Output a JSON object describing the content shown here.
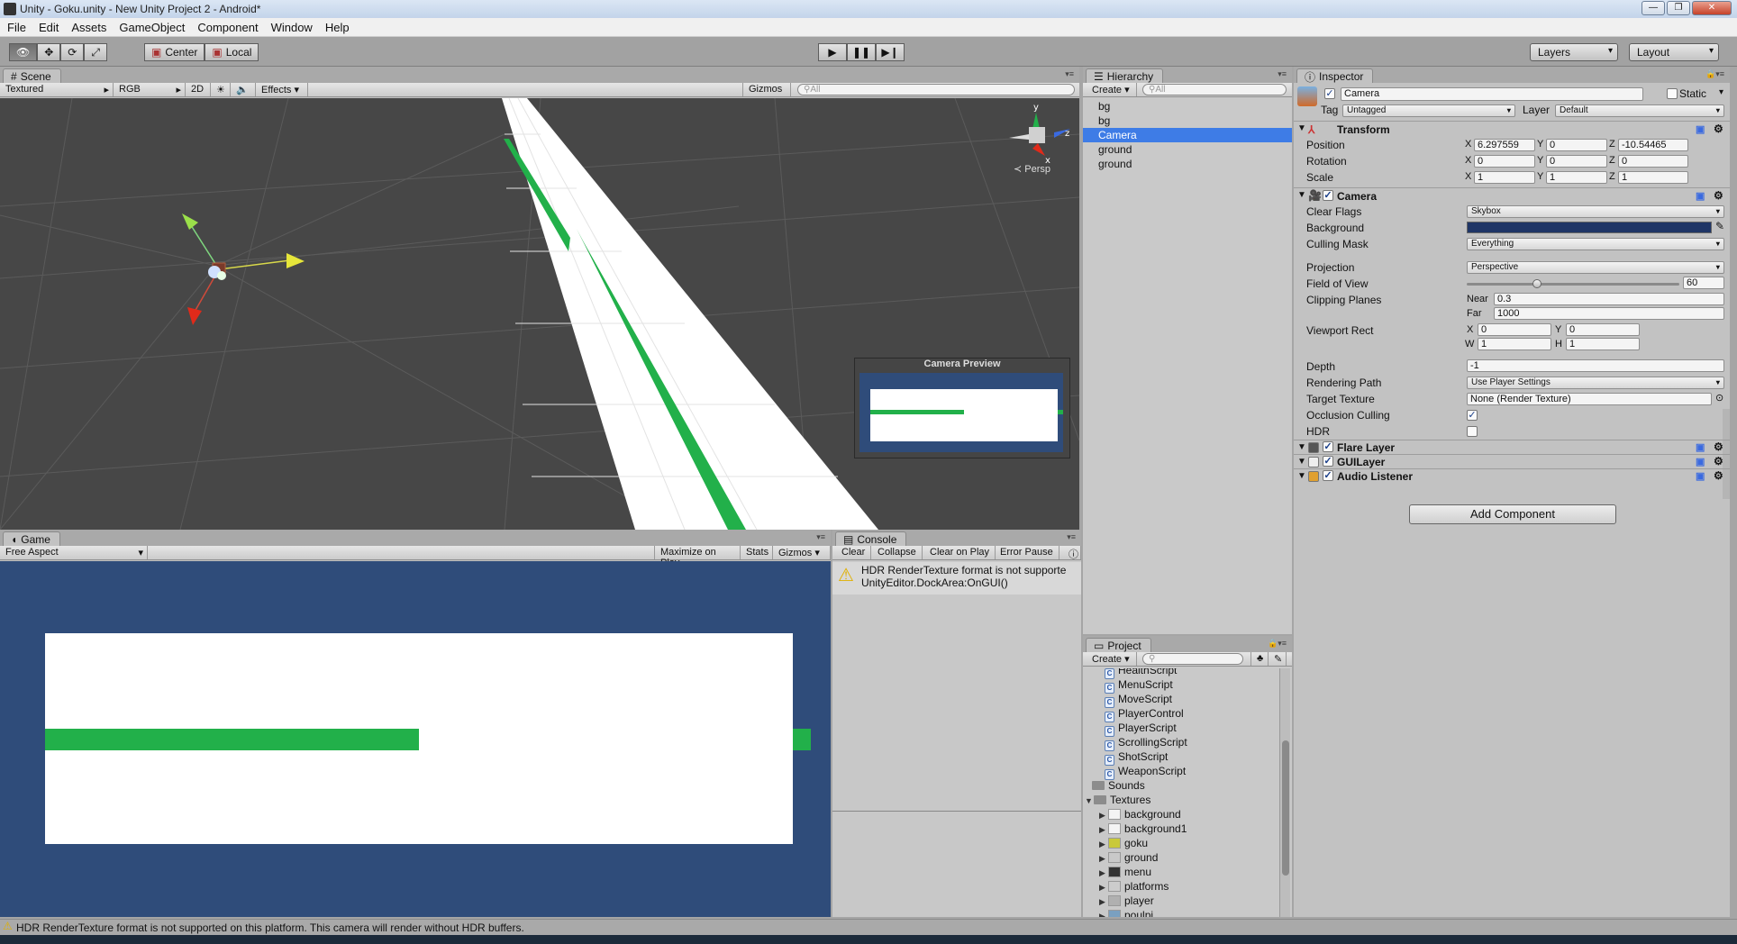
{
  "window": {
    "title": "Unity - Goku.unity - New Unity Project 2 - Android*"
  },
  "menu": [
    "File",
    "Edit",
    "Assets",
    "GameObject",
    "Component",
    "Window",
    "Help"
  ],
  "toolbar": {
    "pivot": "Center",
    "space": "Local",
    "layers": "Layers",
    "layout": "Layout"
  },
  "scene": {
    "tab": "Scene",
    "render_mode": "Textured",
    "color_mode": "RGB",
    "mode_2d": "2D",
    "effects": "Effects",
    "gizmos": "Gizmos",
    "search_placeholder": "All",
    "persp": "Persp",
    "camera_preview_title": "Camera Preview",
    "accent_green": "#22b04a",
    "bg_color": "#474747"
  },
  "game": {
    "tab": "Game",
    "aspect": "Free Aspect",
    "maximize": "Maximize on Play",
    "stats": "Stats",
    "gizmos": "Gizmos",
    "bg_color": "#2f4c7a"
  },
  "console": {
    "tab": "Console",
    "buttons": [
      "Clear",
      "Collapse",
      "Clear on Play",
      "Error Pause"
    ],
    "message_line1": "HDR RenderTexture format is not supporte",
    "message_line2": "UnityEditor.DockArea:OnGUI()"
  },
  "hierarchy": {
    "tab": "Hierarchy",
    "create": "Create",
    "search_placeholder": "All",
    "items": [
      "bg",
      "bg",
      "Camera",
      "ground",
      "ground"
    ],
    "selected_index": 2
  },
  "project": {
    "tab": "Project",
    "create": "Create",
    "partial_item": "HealthScript",
    "scripts": [
      "MenuScript",
      "MoveScript",
      "PlayerControl",
      "PlayerScript",
      "ScrollingScript",
      "ShotScript",
      "WeaponScript"
    ],
    "folders": [
      "Sounds",
      "Textures"
    ],
    "textures": [
      "background",
      "background1",
      "goku",
      "ground",
      "menu",
      "platforms",
      "player",
      "poulpi"
    ]
  },
  "inspector": {
    "tab": "Inspector",
    "object_name": "Camera",
    "static_label": "Static",
    "tag_label": "Tag",
    "tag_value": "Untagged",
    "layer_label": "Layer",
    "layer_value": "Default",
    "transform": {
      "title": "Transform",
      "position_label": "Position",
      "rotation_label": "Rotation",
      "scale_label": "Scale",
      "position": [
        "6.297559",
        "0",
        "-10.54465"
      ],
      "rotation": [
        "0",
        "0",
        "0"
      ],
      "scale": [
        "1",
        "1",
        "1"
      ],
      "axes": [
        "X",
        "Y",
        "Z"
      ]
    },
    "camera": {
      "title": "Camera",
      "clear_flags_label": "Clear Flags",
      "clear_flags": "Skybox",
      "background_label": "Background",
      "background_color": "#1f3566",
      "culling_mask_label": "Culling Mask",
      "culling_mask": "Everything",
      "projection_label": "Projection",
      "projection": "Perspective",
      "fov_label": "Field of View",
      "fov": "60",
      "fov_fraction": 0.33,
      "clipping_label": "Clipping Planes",
      "near_label": "Near",
      "near": "0.3",
      "far_label": "Far",
      "far": "1000",
      "viewport_label": "Viewport Rect",
      "vp_x_label": "X",
      "vp_x": "0",
      "vp_y_label": "Y",
      "vp_y": "0",
      "vp_w_label": "W",
      "vp_w": "1",
      "vp_h_label": "H",
      "vp_h": "1",
      "depth_label": "Depth",
      "depth": "-1",
      "rendering_path_label": "Rendering Path",
      "rendering_path": "Use Player Settings",
      "target_texture_label": "Target Texture",
      "target_texture": "None (Render Texture)",
      "occlusion_label": "Occlusion Culling",
      "hdr_label": "HDR"
    },
    "components": [
      "Flare Layer",
      "GUILayer",
      "Audio Listener"
    ],
    "add_component": "Add Component"
  },
  "statusbar": {
    "message": "HDR RenderTexture format is not supported on this platform. This camera will render without HDR buffers."
  }
}
